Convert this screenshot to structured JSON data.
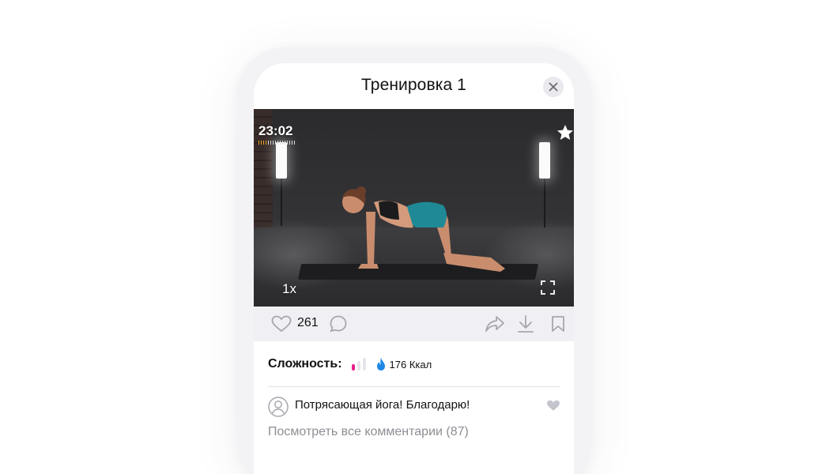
{
  "header": {
    "title": "Тренировка 1",
    "close_icon": "close-icon"
  },
  "video": {
    "timer": "23:02",
    "progress_fraction": 0.25,
    "speed": "1x",
    "favorite_icon": "star-icon",
    "fullscreen_icon": "fullscreen-icon",
    "progress_color": "#f5a623"
  },
  "actions": {
    "likes_count": "261",
    "like_icon": "heart-outline-icon",
    "comment_icon": "comment-icon",
    "share_icon": "share-icon",
    "download_icon": "download-icon",
    "bookmark_icon": "bookmark-icon"
  },
  "stats": {
    "difficulty_label": "Сложность:",
    "difficulty_level": 1,
    "difficulty_max": 3,
    "difficulty_color": "#e91e8c",
    "calories": "176 Ккал",
    "calories_icon": "flame-icon",
    "calories_color": "#1e88e5"
  },
  "comments": {
    "first_comment": "Потрясающая йога! Благодарю!",
    "avatar_icon": "user-avatar-icon",
    "like_icon": "heart-filled-icon",
    "view_all": "Посмотреть все комментарии (87)"
  }
}
